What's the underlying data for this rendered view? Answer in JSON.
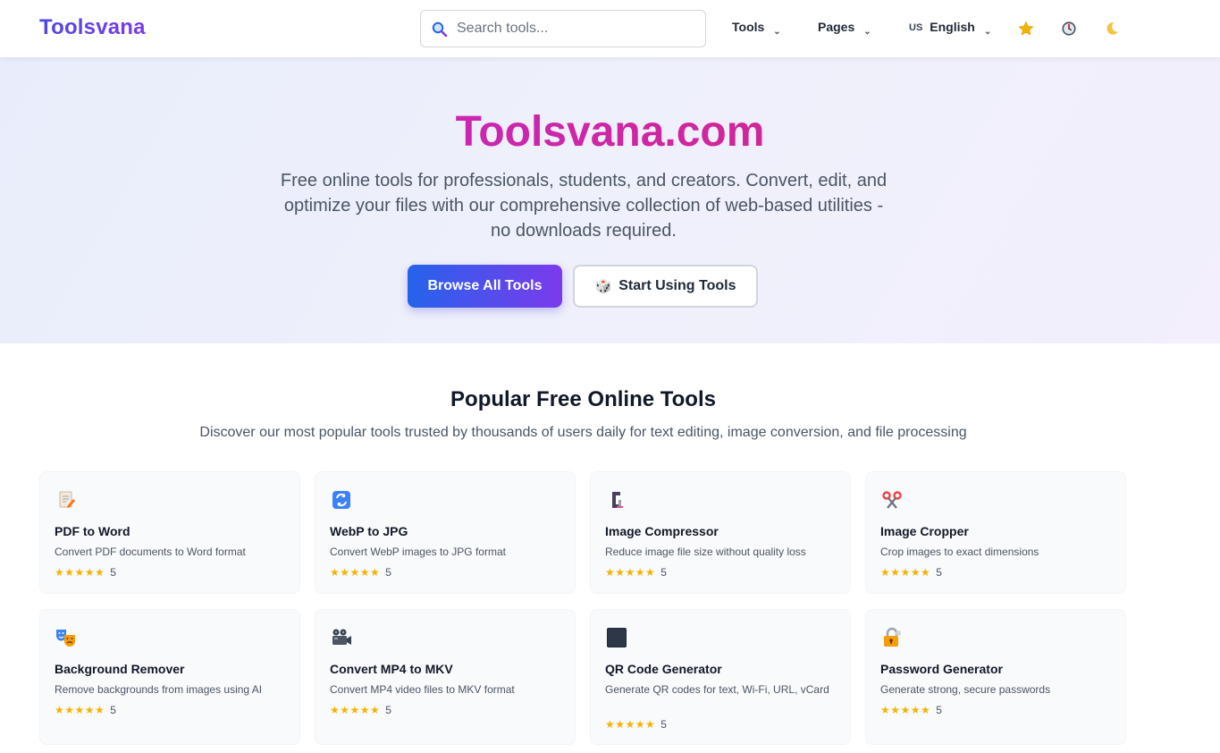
{
  "header": {
    "logo": "Toolsvana",
    "search_placeholder": "Search tools...",
    "nav": {
      "tools": "Tools",
      "pages": "Pages",
      "lang_flag": "US",
      "language": "English"
    },
    "icons": [
      "star-icon",
      "history-clock-icon",
      "moon-icon"
    ]
  },
  "hero": {
    "title": "Toolsvana.com",
    "subtitle": "Free online tools for professionals, students, and creators. Convert, edit, and optimize your files with our comprehensive collection of web-based utilities - no downloads required.",
    "browse_button": "Browse All Tools",
    "start_button": "Start Using Tools"
  },
  "popular": {
    "title": "Popular Free Online Tools",
    "subtitle": "Discover our most popular tools trusted by thousands of users daily for text editing, image conversion, and file processing",
    "tools": [
      {
        "name": "PDF to Word",
        "desc": "Convert PDF documents to Word format",
        "stars": "★★★★★",
        "rating": "5",
        "icon": "memo-icon"
      },
      {
        "name": "WebP to JPG",
        "desc": "Convert WebP images to JPG format",
        "stars": "★★★★★",
        "rating": "5",
        "icon": "refresh-icon"
      },
      {
        "name": "Image Compressor",
        "desc": "Reduce image file size without quality loss",
        "stars": "★★★★★",
        "rating": "5",
        "icon": "clamp-icon"
      },
      {
        "name": "Image Cropper",
        "desc": "Crop images to exact dimensions",
        "stars": "★★★★★",
        "rating": "5",
        "icon": "scissors-icon"
      },
      {
        "name": "Background Remover",
        "desc": "Remove backgrounds from images using AI",
        "stars": "★★★★★",
        "rating": "5",
        "icon": "theater-masks-icon"
      },
      {
        "name": "Convert MP4 to MKV",
        "desc": "Convert MP4 video files to MKV format",
        "stars": "★★★★★",
        "rating": "5",
        "icon": "film-camera-icon"
      },
      {
        "name": "QR Code Generator",
        "desc": "Generate QR codes for text, Wi-Fi, URL, vCard",
        "stars": "★★★★★",
        "rating": "5",
        "icon": "black-square-icon"
      },
      {
        "name": "Password Generator",
        "desc": "Generate strong, secure passwords",
        "stars": "★★★★★",
        "rating": "5",
        "icon": "lock-icon"
      }
    ]
  }
}
